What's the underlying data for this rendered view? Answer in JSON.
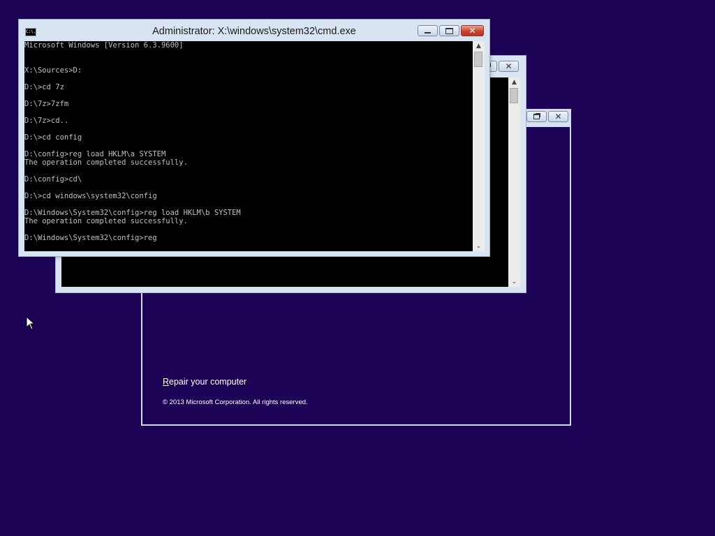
{
  "desktop": {
    "background": "#1d0356"
  },
  "setup_window": {
    "repair_link_accel": "R",
    "repair_link_rest": "epair your computer",
    "copyright": "© 2013 Microsoft Corporation. All rights reserved."
  },
  "cmd_window": {
    "title": "Administrator: X:\\windows\\system32\\cmd.exe",
    "icon_text": "C:\\.",
    "output": "Microsoft Windows [Version 6.3.9600]\n\n\nX:\\Sources>D:\n\nD:\\>cd 7z\n\nD:\\7z>7zfm\n\nD:\\7z>cd..\n\nD:\\>cd config\n\nD:\\config>reg load HKLM\\a SYSTEM\nThe operation completed successfully.\n\nD:\\config>cd\\\n\nD:\\>cd windows\\system32\\config\n\nD:\\Windows\\System32\\config>reg load HKLM\\b SYSTEM\nThe operation completed successfully.\n\nD:\\Windows\\System32\\config>reg",
    "scroll_up_glyph": "▲",
    "scroll_down_glyph": "⌄"
  },
  "icons": {
    "minimize": "minimize-icon",
    "maximize": "maximize-icon",
    "restore": "restore-icon",
    "close": "close-icon",
    "cursor": "mouse-pointer-icon",
    "close_glyph": "✕"
  },
  "colors": {
    "console_bg": "#000000",
    "console_text": "#c0c0c0",
    "window_frame": "#d8e4f2",
    "close_button": "#c7452d"
  }
}
